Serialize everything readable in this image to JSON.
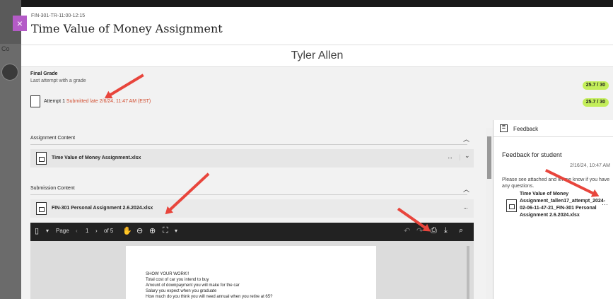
{
  "header": {
    "course_id": "FIN-301-TR-11:00-12:15",
    "title": "Time Value of Money Assignment",
    "close_label": "×"
  },
  "student": {
    "name": "Tyler Allen"
  },
  "grade": {
    "final_grade_label": "Final Grade",
    "subtitle": "Last attempt with a grade",
    "final_value": "25.7 / 30",
    "attempt_label": "Attempt 1",
    "attempt_status": "Submitted late 2/6/24, 11:47 AM (EST)",
    "attempt_value": "25.7 / 30"
  },
  "assignment_content": {
    "heading": "Assignment Content",
    "file_name": "Time Value of Money Assignment.xlsx",
    "more": "···",
    "chevron": "⌄"
  },
  "submission_content": {
    "heading": "Submission Content",
    "file_name": "FIN-301 Personal Assignment 2.6.2024.xlsx",
    "more": "···"
  },
  "viewer": {
    "page_label": "Page",
    "page_number": "1",
    "of_pages": "of 5",
    "document_lines": [
      "SHOW YOUR WORK!!",
      "Total cost of car you intend to buy",
      "Amount of downpayment you will make for the car",
      "Salary you expect when you graduate",
      "How much do you think you will need annual when you retire at 65?"
    ]
  },
  "feedback": {
    "title": "Feedback",
    "for_student": "Feedback for student",
    "date": "2/16/24, 10:47 AM",
    "note": "Please see attached and let me know if you have any questions.",
    "file_name": "Time Value of Money Assignment_tallen17_attempt_2024-02-06-11-47-21_FIN-301 Personal Assignment 2.6.2024.xlsx",
    "more": "···"
  },
  "colors": {
    "accent": "#b45bc7",
    "grade_pill": "#c3ee5a",
    "late_text": "#d14b2d",
    "annotation_arrow": "#e8453c",
    "viewer_toolbar": "#222222"
  }
}
